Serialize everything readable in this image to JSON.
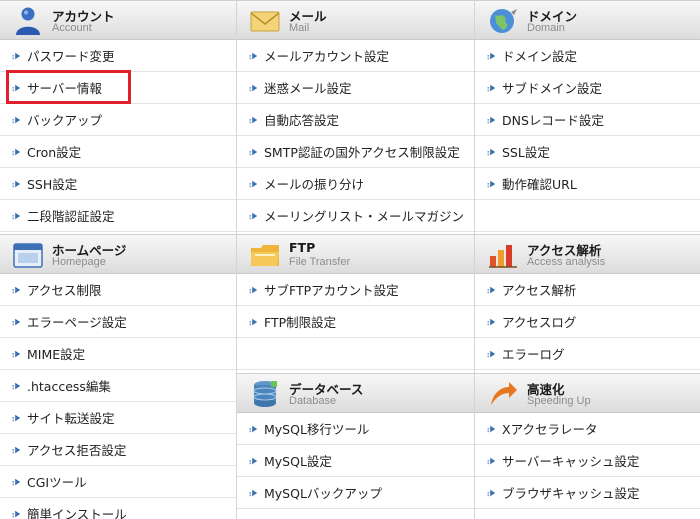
{
  "columns": [
    {
      "sections": [
        {
          "key": "account",
          "title": "アカウント",
          "subtitle": "Account",
          "icon": "user-icon",
          "items": [
            "パスワード変更",
            "サーバー情報",
            "バックアップ",
            "Cron設定",
            "SSH設定",
            "二段階認証設定"
          ]
        },
        {
          "key": "homepage",
          "title": "ホームページ",
          "subtitle": "Homepage",
          "icon": "browser-window-icon",
          "items": [
            "アクセス制限",
            "エラーページ設定",
            "MIME設定",
            ".htaccess編集",
            "サイト転送設定",
            "アクセス拒否設定",
            "CGIツール",
            "簡単インストール"
          ]
        }
      ]
    },
    {
      "sections": [
        {
          "key": "mail",
          "title": "メール",
          "subtitle": "Mail",
          "icon": "envelope-icon",
          "items": [
            "メールアカウント設定",
            "迷惑メール設定",
            "自動応答設定",
            "SMTP認証の国外アクセス制限設定",
            "メールの振り分け",
            "メーリングリスト・メールマガジン"
          ]
        },
        {
          "key": "ftp",
          "title": "FTP",
          "subtitle": "File Transfer",
          "icon": "folder-icon",
          "items": [
            "サブFTPアカウント設定",
            "FTP制限設定",
            ""
          ]
        },
        {
          "key": "database",
          "title": "データベース",
          "subtitle": "Database",
          "icon": "database-icon",
          "items": [
            "MySQL移行ツール",
            "MySQL設定",
            "MySQLバックアップ"
          ]
        }
      ]
    },
    {
      "sections": [
        {
          "key": "domain",
          "title": "ドメイン",
          "subtitle": "Domain",
          "icon": "globe-icon",
          "items": [
            "ドメイン設定",
            "サブドメイン設定",
            "DNSレコード設定",
            "SSL設定",
            "動作確認URL",
            ""
          ]
        },
        {
          "key": "access-analysis",
          "title": "アクセス解析",
          "subtitle": "Access analysis",
          "icon": "bar-chart-icon",
          "items": [
            "アクセス解析",
            "アクセスログ",
            "エラーログ"
          ]
        },
        {
          "key": "speedup",
          "title": "高速化",
          "subtitle": "Speeding Up",
          "icon": "speed-arrow-icon",
          "items": [
            "Xアクセラレータ",
            "サーバーキャッシュ設定",
            "ブラウザキャッシュ設定"
          ]
        }
      ]
    }
  ],
  "highlight": {
    "target": "サーバー情報",
    "color": "#e0202c"
  }
}
